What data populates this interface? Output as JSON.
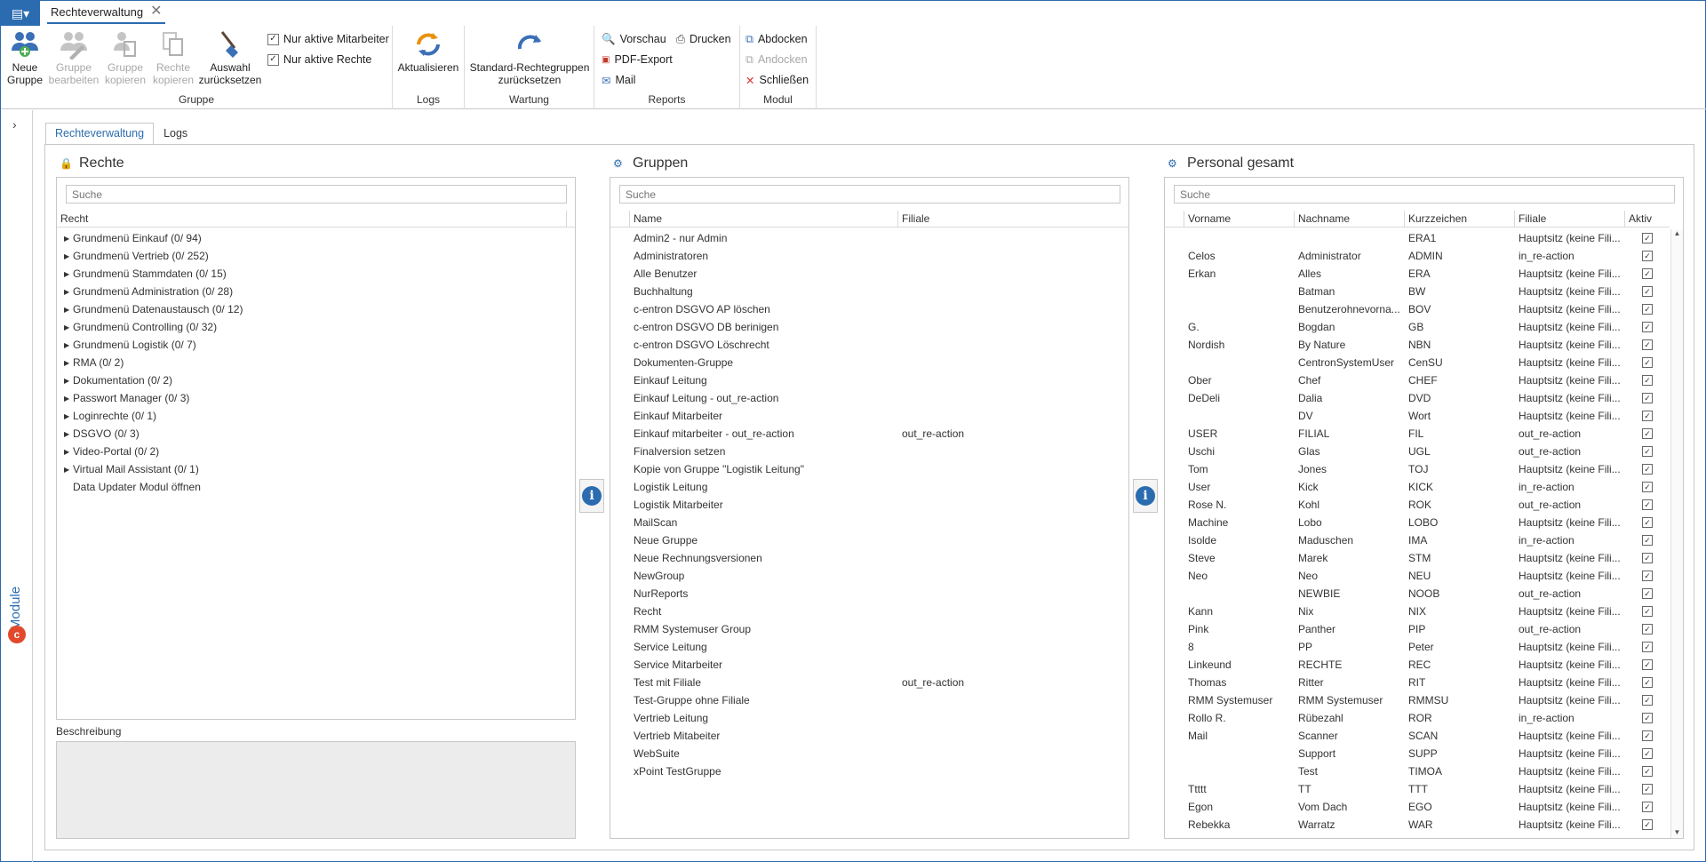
{
  "doc_tab": {
    "title": "Rechteverwaltung"
  },
  "ribbon": {
    "gruppe": {
      "label": "Gruppe",
      "neue_gruppe": "Neue\nGruppe",
      "gruppe_bearbeiten": "Gruppe\nbearbeiten",
      "gruppe_kopieren": "Gruppe\nkopieren",
      "rechte_kopieren": "Rechte\nkopieren",
      "auswahl_zuruecksetzen": "Auswahl\nzurücksetzen",
      "nur_aktive_mitarbeiter": "Nur aktive Mitarbeiter",
      "nur_aktive_rechte": "Nur aktive Rechte"
    },
    "logs": {
      "label": "Logs",
      "aktualisieren": "Aktualisieren"
    },
    "wartung": {
      "label": "Wartung",
      "standard": "Standard-Rechtegruppen\nzurücksetzen"
    },
    "reports": {
      "label": "Reports",
      "vorschau": "Vorschau",
      "drucken": "Drucken",
      "pdf": "PDF-Export",
      "mail": "Mail"
    },
    "modul": {
      "label": "Modul",
      "abdocken": "Abdocken",
      "andocken": "Andocken",
      "schliessen": "Schließen"
    }
  },
  "module_strip": {
    "label": "Module"
  },
  "content_tabs": [
    "Rechteverwaltung",
    "Logs"
  ],
  "rechte": {
    "title": "Rechte",
    "search_placeholder": "Suche",
    "column": "Recht",
    "items": [
      {
        "label": "Grundmenü Einkauf (0/ 94)",
        "expand": true
      },
      {
        "label": "Grundmenü Vertrieb (0/ 252)",
        "expand": true
      },
      {
        "label": "Grundmenü Stammdaten (0/ 15)",
        "expand": true
      },
      {
        "label": "Grundmenü Administration (0/ 28)",
        "expand": true
      },
      {
        "label": "Grundmenü Datenaustausch (0/ 12)",
        "expand": true
      },
      {
        "label": "Grundmenü Controlling (0/ 32)",
        "expand": true
      },
      {
        "label": "Grundmenü Logistik (0/ 7)",
        "expand": true
      },
      {
        "label": "RMA (0/ 2)",
        "expand": true
      },
      {
        "label": "Dokumentation (0/ 2)",
        "expand": true
      },
      {
        "label": "Passwort Manager (0/ 3)",
        "expand": true
      },
      {
        "label": "Loginrechte (0/ 1)",
        "expand": true
      },
      {
        "label": "DSGVO (0/ 3)",
        "expand": true
      },
      {
        "label": "Video-Portal (0/ 2)",
        "expand": true
      },
      {
        "label": "Virtual Mail Assistant (0/ 1)",
        "expand": true
      },
      {
        "label": "Data Updater Modul öffnen",
        "expand": false
      }
    ],
    "beschreibung_label": "Beschreibung"
  },
  "gruppen": {
    "title": "Gruppen",
    "search_placeholder": "Suche",
    "columns": [
      "Name",
      "Filiale"
    ],
    "rows": [
      [
        "Admin2 - nur Admin",
        ""
      ],
      [
        "Administratoren",
        ""
      ],
      [
        "Alle Benutzer",
        ""
      ],
      [
        "Buchhaltung",
        ""
      ],
      [
        "c-entron DSGVO AP löschen",
        ""
      ],
      [
        "c-entron DSGVO DB berinigen",
        ""
      ],
      [
        "c-entron DSGVO Löschrecht",
        ""
      ],
      [
        "Dokumenten-Gruppe",
        ""
      ],
      [
        "Einkauf Leitung",
        ""
      ],
      [
        "Einkauf Leitung - out_re-action",
        ""
      ],
      [
        "Einkauf Mitarbeiter",
        ""
      ],
      [
        "Einkauf mitarbeiter - out_re-action",
        "out_re-action"
      ],
      [
        "Finalversion setzen",
        ""
      ],
      [
        "Kopie von Gruppe \"Logistik Leitung\"",
        ""
      ],
      [
        "Logistik Leitung",
        ""
      ],
      [
        "Logistik Mitarbeiter",
        ""
      ],
      [
        "MailScan",
        ""
      ],
      [
        "Neue Gruppe",
        ""
      ],
      [
        "Neue Rechnungsversionen",
        ""
      ],
      [
        "NewGroup",
        ""
      ],
      [
        "NurReports",
        ""
      ],
      [
        "Recht",
        ""
      ],
      [
        "RMM Systemuser Group",
        ""
      ],
      [
        "Service Leitung",
        ""
      ],
      [
        "Service Mitarbeiter",
        ""
      ],
      [
        "Test mit Filiale",
        "out_re-action"
      ],
      [
        "Test-Gruppe ohne Filiale",
        ""
      ],
      [
        "Vertrieb Leitung",
        ""
      ],
      [
        "Vertrieb Mitabeiter",
        ""
      ],
      [
        "WebSuite",
        ""
      ],
      [
        "xPoint TestGruppe",
        ""
      ]
    ]
  },
  "personal": {
    "title": "Personal gesamt",
    "search_placeholder": "Suche",
    "columns": [
      "Vorname",
      "Nachname",
      "Kurzzeichen",
      "Filiale",
      "Aktiv"
    ],
    "rows": [
      [
        "",
        "",
        "ERA1",
        "Hauptsitz (keine Fili..."
      ],
      [
        "Celos",
        "Administrator",
        "ADMIN",
        "in_re-action"
      ],
      [
        "Erkan",
        "Alles",
        "ERA",
        "Hauptsitz (keine Fili..."
      ],
      [
        "",
        "Batman",
        "BW",
        "Hauptsitz (keine Fili..."
      ],
      [
        "",
        "Benutzerohnevorna...",
        "BOV",
        "Hauptsitz (keine Fili..."
      ],
      [
        "G.",
        "Bogdan",
        "GB",
        "Hauptsitz (keine Fili..."
      ],
      [
        "Nordish",
        "By Nature",
        "NBN",
        "Hauptsitz (keine Fili..."
      ],
      [
        "",
        "CentronSystemUser",
        "CenSU",
        "Hauptsitz (keine Fili..."
      ],
      [
        "Ober",
        "Chef",
        "CHEF",
        "Hauptsitz (keine Fili..."
      ],
      [
        "DeDeli",
        "Dalia",
        "DVD",
        "Hauptsitz (keine Fili..."
      ],
      [
        "",
        "DV",
        "Wort",
        "Hauptsitz (keine Fili..."
      ],
      [
        "USER",
        "FILIAL",
        "FIL",
        "out_re-action"
      ],
      [
        "Uschi",
        "Glas",
        "UGL",
        "out_re-action"
      ],
      [
        "Tom",
        "Jones",
        "TOJ",
        "Hauptsitz (keine Fili..."
      ],
      [
        "User",
        "Kick",
        "KICK",
        "in_re-action"
      ],
      [
        "Rose N.",
        "Kohl",
        "ROK",
        "out_re-action"
      ],
      [
        "Machine",
        "Lobo",
        "LOBO",
        "Hauptsitz (keine Fili..."
      ],
      [
        "Isolde",
        "Maduschen",
        "IMA",
        "in_re-action"
      ],
      [
        "Steve",
        "Marek",
        "STM",
        "Hauptsitz (keine Fili..."
      ],
      [
        "Neo",
        "Neo",
        "NEU",
        "Hauptsitz (keine Fili..."
      ],
      [
        "",
        "NEWBIE",
        "NOOB",
        "out_re-action"
      ],
      [
        "Kann",
        "Nix",
        "NIX",
        "Hauptsitz (keine Fili..."
      ],
      [
        "Pink",
        "Panther",
        "PIP",
        "out_re-action"
      ],
      [
        "8",
        "PP",
        "Peter",
        "Hauptsitz (keine Fili..."
      ],
      [
        "Linkeund",
        "RECHTE",
        "REC",
        "Hauptsitz (keine Fili..."
      ],
      [
        "Thomas",
        "Ritter",
        "RIT",
        "Hauptsitz (keine Fili..."
      ],
      [
        "RMM Systemuser",
        "RMM Systemuser",
        "RMMSU",
        "Hauptsitz (keine Fili..."
      ],
      [
        "Rollo R.",
        "Rübezahl",
        "ROR",
        "in_re-action"
      ],
      [
        "Mail",
        "Scanner",
        "SCAN",
        "Hauptsitz (keine Fili..."
      ],
      [
        "",
        "Support",
        "SUPP",
        "Hauptsitz (keine Fili..."
      ],
      [
        "",
        "Test",
        "TIMOA",
        "Hauptsitz (keine Fili..."
      ],
      [
        "Ttttt",
        "TT",
        "TTT",
        "Hauptsitz (keine Fili..."
      ],
      [
        "Egon",
        "Vom Dach",
        "EGO",
        "Hauptsitz (keine Fili..."
      ],
      [
        "Rebekka",
        "Warratz",
        "WAR",
        "Hauptsitz (keine Fili..."
      ]
    ]
  },
  "colors": {
    "accent": "#2b6cb0",
    "logo": "#e2482b"
  }
}
